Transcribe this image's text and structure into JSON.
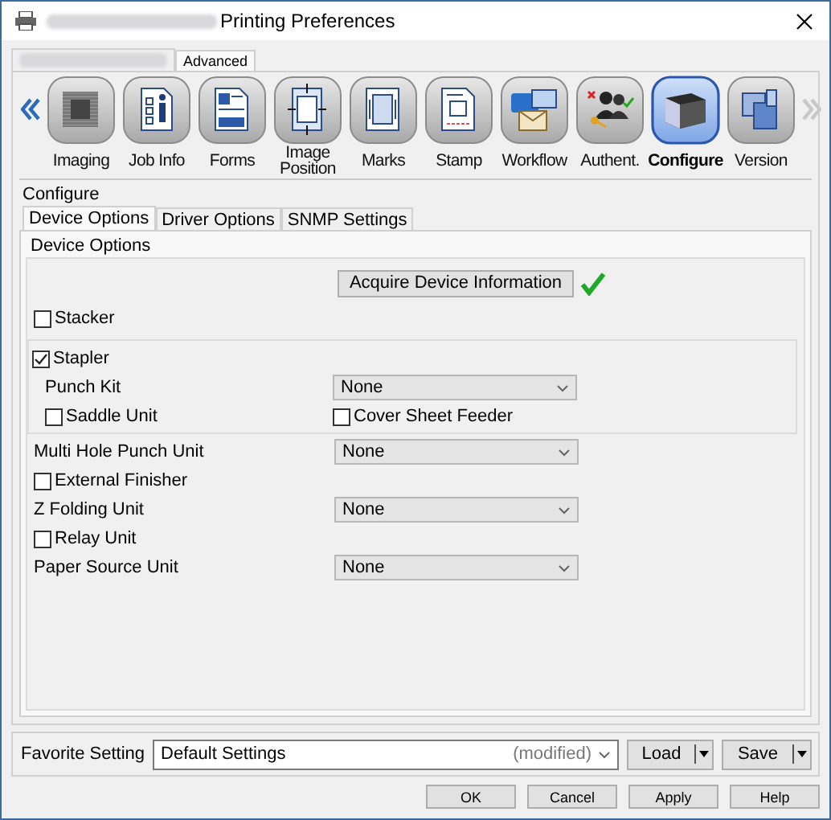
{
  "window": {
    "title": "Printing Preferences"
  },
  "top_tabs": [
    {
      "kind": "blurred",
      "selected": true
    },
    {
      "kind": "text",
      "label": "Advanced",
      "selected": false
    }
  ],
  "toolbar": {
    "items": [
      {
        "label": "Imaging",
        "selected": false
      },
      {
        "label": "Job Info",
        "selected": false
      },
      {
        "label": "Forms",
        "selected": false
      },
      {
        "label": "Image Position",
        "selected": false
      },
      {
        "label": "Marks",
        "selected": false
      },
      {
        "label": "Stamp",
        "selected": false
      },
      {
        "label": "Workflow",
        "selected": false
      },
      {
        "label": "Authent.",
        "selected": false
      },
      {
        "label": "Configure",
        "selected": true
      },
      {
        "label": "Version",
        "selected": false
      }
    ]
  },
  "configure": {
    "title": "Configure",
    "tabs": [
      {
        "label": "Device Options",
        "selected": true
      },
      {
        "label": "Driver Options",
        "selected": false
      },
      {
        "label": "SNMP Settings",
        "selected": false
      }
    ],
    "group": {
      "title": "Device Options",
      "acquire_button": "Acquire Device Information",
      "acquired": true,
      "rows": [
        {
          "kind": "checkbox",
          "label": "Stacker",
          "checked": false
        },
        {
          "kind": "section",
          "children": [
            {
              "kind": "checkbox",
              "label": "Stapler",
              "checked": true
            },
            {
              "kind": "select",
              "label": "Punch Kit",
              "value": "None"
            },
            {
              "kind": "pair",
              "items": [
                {
                  "label": "Saddle Unit",
                  "checked": false
                },
                {
                  "label": "Cover Sheet Feeder",
                  "checked": false
                }
              ]
            }
          ]
        },
        {
          "kind": "select",
          "label": "Multi Hole Punch Unit",
          "value": "None"
        },
        {
          "kind": "checkbox",
          "label": "External Finisher",
          "checked": false
        },
        {
          "kind": "select",
          "label": "Z Folding Unit",
          "value": "None"
        },
        {
          "kind": "checkbox",
          "label": "Relay Unit",
          "checked": false
        },
        {
          "kind": "select",
          "label": "Paper Source Unit",
          "value": "None"
        }
      ]
    }
  },
  "favorite": {
    "label": "Favorite Setting",
    "value": "Default Settings",
    "note": "(modified)",
    "buttons": [
      "Load",
      "Save"
    ]
  },
  "buttons": [
    "OK",
    "Cancel",
    "Apply",
    "Help"
  ]
}
